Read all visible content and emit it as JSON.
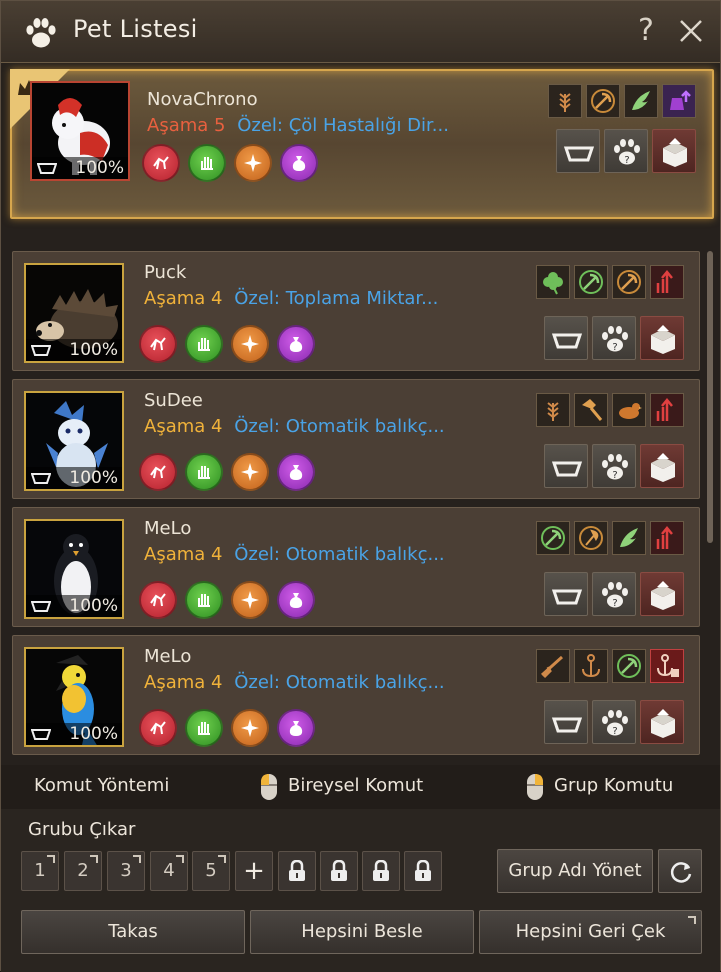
{
  "window": {
    "title": "Pet Listesi",
    "help_label": "?"
  },
  "pets": [
    {
      "name": "NovaChrono",
      "stage_label": "Aşama",
      "stage": "5",
      "special": "Özel: Çöl Hastalığı Dir...",
      "feed": "100%",
      "leader": true,
      "talents": [
        "wheat-icon",
        "pickaxe-icon",
        "wing-icon",
        "upgrade-potion-icon"
      ]
    },
    {
      "name": "Puck",
      "stage_label": "Aşama",
      "stage": "4",
      "special": "Özel: Toplama Miktar...",
      "feed": "100%",
      "leader": false,
      "talents": [
        "clover-icon",
        "pickaxe-icon",
        "pickaxe-icon",
        "stat-up-icon"
      ]
    },
    {
      "name": "SuDee",
      "stage_label": "Aşama",
      "stage": "4",
      "special": "Özel: Otomatik balıkç...",
      "feed": "100%",
      "leader": false,
      "talents": [
        "wheat-icon",
        "hammer-icon",
        "bird-icon",
        "stat-up-icon"
      ]
    },
    {
      "name": "MeLo",
      "stage_label": "Aşama",
      "stage": "4",
      "special": "Özel: Otomatik balıkç...",
      "feed": "100%",
      "leader": false,
      "talents": [
        "pickaxe-icon",
        "axe-icon",
        "wing-icon",
        "stat-up-icon"
      ]
    },
    {
      "name": "MeLo",
      "stage_label": "Aşama",
      "stage": "4",
      "special": "Özel: Otomatik balıkç...",
      "feed": "100%",
      "leader": false,
      "talents": [
        "musket-icon",
        "anchor-icon",
        "pickaxe-icon",
        "locked-anchor-icon"
      ]
    }
  ],
  "command_bar": {
    "method_label": "Komut Yöntemi",
    "individual_label": "Bireysel Komut",
    "group_label": "Grup Komutu"
  },
  "groups": {
    "remove_label": "Grubu Çıkar",
    "slots": [
      "1",
      "2",
      "3",
      "4",
      "5"
    ],
    "add_label": "+",
    "manage_label": "Grup Adı Yönet"
  },
  "footer": {
    "swap_label": "Takas",
    "feed_all_label": "Hepsini Besle",
    "recall_all_label": "Hepsini Geri Çek"
  },
  "colors": {
    "stage_leader": "#e8603f",
    "stage": "#f0b23a",
    "special": "#4aa3e6",
    "leader_border": "#d6a64d"
  }
}
